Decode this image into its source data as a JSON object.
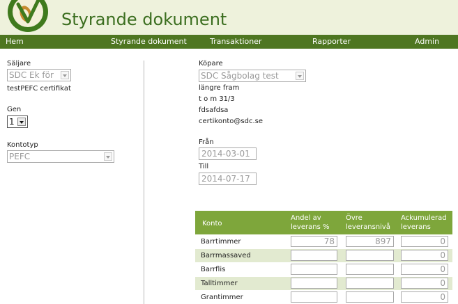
{
  "app": {
    "title": "Styrande dokument"
  },
  "nav": {
    "items": [
      {
        "label": "Hem"
      },
      {
        "label": "Styrande dokument"
      },
      {
        "label": "Transaktioner"
      },
      {
        "label": "Rapporter"
      },
      {
        "label": "Admin"
      }
    ]
  },
  "seller": {
    "label": "Säljare",
    "value": "SDC Ek för",
    "cert": "testPEFC certifikat"
  },
  "gen": {
    "label": "Gen",
    "value": "1"
  },
  "kontotyp": {
    "label": "Kontotyp",
    "value": "PEFC"
  },
  "buyer": {
    "label": "Köpare",
    "value": "SDC Sågbolag test",
    "info": [
      "längre fram",
      "t o m 31/3",
      "fdsafdsa",
      "certikonto@sdc.se"
    ]
  },
  "from": {
    "label": "Från",
    "value": "2014-03-01"
  },
  "to": {
    "label": "Till",
    "value": "2014-07-17"
  },
  "table": {
    "headers": {
      "konto": "Konto",
      "andel_1": "Andel av",
      "andel_2": "leverans %",
      "ovre_1": "Övre",
      "ovre_2": "leveransnivå",
      "ack_1": "Ackumulerad",
      "ack_2": "leverans"
    },
    "rows": [
      {
        "name": "Barrtimmer",
        "andel": "78",
        "ovre": "897",
        "ack": "0"
      },
      {
        "name": "Barrmassaved",
        "andel": "",
        "ovre": "",
        "ack": "0"
      },
      {
        "name": "Barrflis",
        "andel": "",
        "ovre": "",
        "ack": "0"
      },
      {
        "name": "Talltimmer",
        "andel": "",
        "ovre": "",
        "ack": "0"
      },
      {
        "name": "Grantimmer",
        "andel": "",
        "ovre": "",
        "ack": "0"
      }
    ]
  }
}
